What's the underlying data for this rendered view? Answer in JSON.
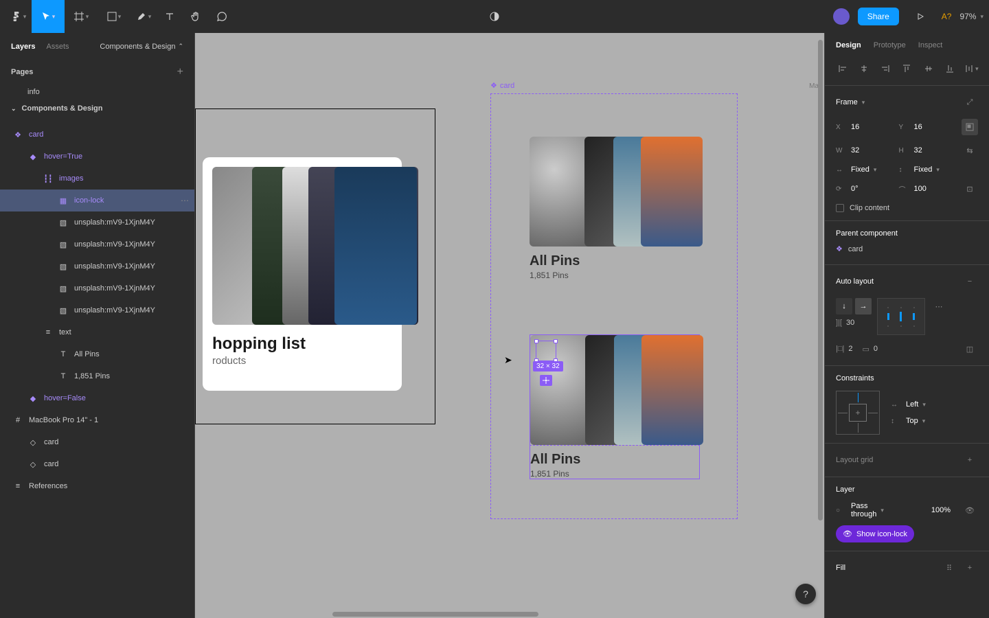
{
  "toolbar": {
    "share": "Share",
    "aq": "A?",
    "zoom": "97%"
  },
  "left": {
    "tab_layers": "Layers",
    "tab_assets": "Assets",
    "file_menu": "Components & Design",
    "pages_label": "Pages",
    "page_info": "info",
    "page_current": "Components & Design",
    "layers": {
      "card": "card",
      "hover_true": "hover=True",
      "images": "images",
      "icon_lock": "icon-lock",
      "img1": "unsplash:mV9-1XjnM4Y",
      "img2": "unsplash:mV9-1XjnM4Y",
      "img3": "unsplash:mV9-1XjnM4Y",
      "img4": "unsplash:mV9-1XjnM4Y",
      "img5": "unsplash:mV9-1XjnM4Y",
      "text": "text",
      "all_pins": "All Pins",
      "pins_count": "1,851 Pins",
      "hover_false": "hover=False",
      "macbook": "MacBook Pro 14\" - 1",
      "inst_card1": "card",
      "inst_card2": "card",
      "refs": "References"
    }
  },
  "right": {
    "tab_design": "Design",
    "tab_prototype": "Prototype",
    "tab_inspect": "Inspect",
    "frame_label": "Frame",
    "x_label": "X",
    "x_val": "16",
    "y_label": "Y",
    "y_val": "16",
    "w_label": "W",
    "w_val": "32",
    "h_label": "H",
    "h_val": "32",
    "fixed1": "Fixed",
    "fixed2": "Fixed",
    "rot": "0°",
    "radius": "100",
    "clip": "Clip content",
    "parent_label": "Parent component",
    "parent_val": "card",
    "auto_layout": "Auto layout",
    "gap": "30",
    "hpad": "2",
    "vpad": "0",
    "constraints": "Constraints",
    "c_left": "Left",
    "c_top": "Top",
    "layout_grid": "Layout grid",
    "layer_section": "Layer",
    "blend": "Pass through",
    "opacity": "100%",
    "show_lock": "Show icon-lock",
    "fill": "Fill"
  },
  "canvas": {
    "comp_name": "card",
    "shop_title": "hopping list",
    "shop_sub": "roducts",
    "card_title": "All Pins",
    "card_sub": "1,851 Pins",
    "dim": "32 × 32",
    "mac": "Mac"
  }
}
